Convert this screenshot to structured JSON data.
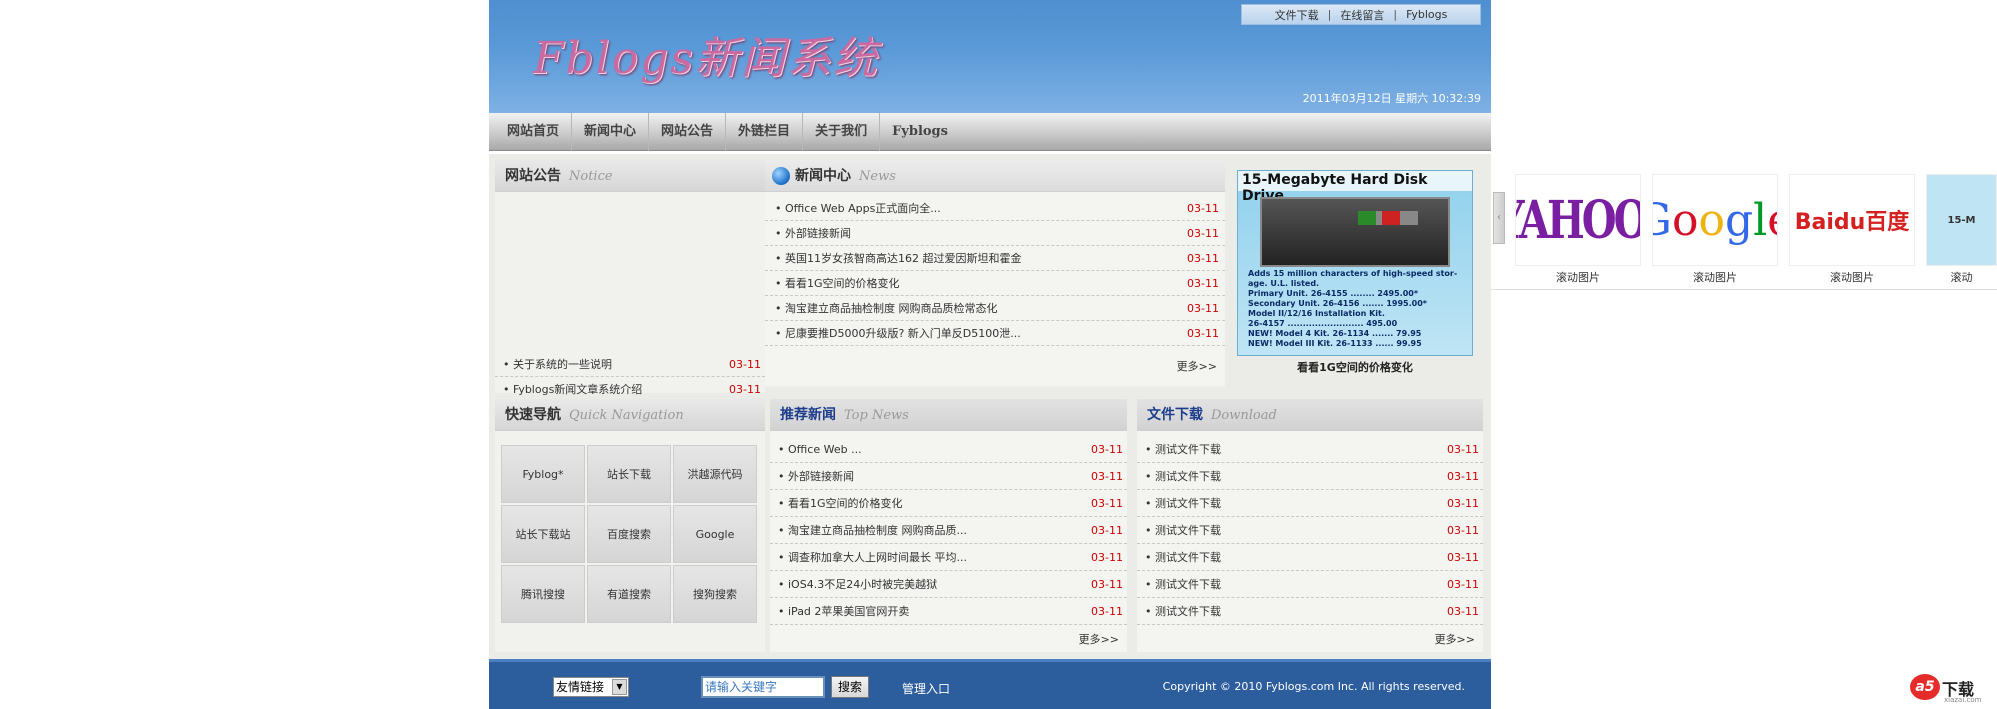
{
  "header": {
    "logo_text": "Fblogs新闻系统",
    "toplinks": [
      "文件下载",
      "在线留言",
      "Fyblogs"
    ],
    "toplinks_sep": "|",
    "datetime": "2011年03月12日 星期六 10:32:39"
  },
  "nav": {
    "items": [
      "网站首页",
      "新闻中心",
      "网站公告",
      "外链栏目",
      "关于我们",
      "Fyblogs"
    ]
  },
  "notice": {
    "title": "网站公告",
    "title_en": "Notice",
    "items": [
      {
        "title": "关于系统的一些说明",
        "date": "03-11"
      },
      {
        "title": "Fyblogs新闻文章系统介绍",
        "date": "03-11"
      }
    ]
  },
  "quicknav": {
    "title": "快速导航",
    "title_en": "Quick Navigation",
    "links": [
      "Fyblog*",
      "站长下载",
      "洪越源代码",
      "站长下载站",
      "百度搜索",
      "Google",
      "腾讯搜搜",
      "有道搜索",
      "搜狗搜索"
    ]
  },
  "news": {
    "title": "新闻中心",
    "title_en": "News",
    "items": [
      {
        "title": "Office Web Apps正式面向全...",
        "date": "03-11"
      },
      {
        "title": "外部链接新闻",
        "date": "03-11"
      },
      {
        "title": "英国11岁女孩智商高达162 超过爱因斯坦和霍金",
        "date": "03-11"
      },
      {
        "title": "看看1G空间的价格变化",
        "date": "03-11"
      },
      {
        "title": "淘宝建立商品抽检制度 网购商品质检常态化",
        "date": "03-11"
      },
      {
        "title": "尼康要推D5000升级版? 新入门单反D5100泄...",
        "date": "03-11"
      }
    ],
    "more": "更多>>"
  },
  "ad": {
    "heading": "15-Megabyte Hard Disk Drive",
    "lines": [
      "Adds 15 million characters of high-speed stor-",
      "age. U.L. listed.",
      "Primary Unit. 26-4155 ........ 2495.00*",
      "Secondary Unit. 26-4156 ....... 1995.00*",
      "Model II/12/16 Installation Kit.",
      "26-4157 ......................... 495.00",
      "NEW! Model 4 Kit. 26-1134 ....... 79.95",
      "NEW! Model III Kit. 26-1133 ...... 99.95"
    ],
    "caption": "看看1G空间的价格变化"
  },
  "topnews": {
    "title": "推荐新闻",
    "title_en": "Top News",
    "items": [
      {
        "title": "Office Web ...",
        "date": "03-11"
      },
      {
        "title": "外部链接新闻",
        "date": "03-11"
      },
      {
        "title": "看看1G空间的价格变化",
        "date": "03-11"
      },
      {
        "title": "淘宝建立商品抽检制度 网购商品质...",
        "date": "03-11"
      },
      {
        "title": "调查称加拿大人上网时间最长 平均...",
        "date": "03-11"
      },
      {
        "title": "iOS4.3不足24小时被完美越狱",
        "date": "03-11"
      },
      {
        "title": "iPad 2苹果美国官网开卖",
        "date": "03-11"
      }
    ],
    "more": "更多>>"
  },
  "download": {
    "title": "文件下载",
    "title_en": "Download",
    "items": [
      {
        "title": "测试文件下载",
        "date": "03-11"
      },
      {
        "title": "测试文件下载",
        "date": "03-11"
      },
      {
        "title": "测试文件下载",
        "date": "03-11"
      },
      {
        "title": "测试文件下载",
        "date": "03-11"
      },
      {
        "title": "测试文件下载",
        "date": "03-11"
      },
      {
        "title": "测试文件下载",
        "date": "03-11"
      },
      {
        "title": "测试文件下载",
        "date": "03-11"
      }
    ],
    "more": "更多>>"
  },
  "footer": {
    "friend_links": "友情链接",
    "search_placeholder": "请输入关键字",
    "search_button": "搜索",
    "admin": "管理入口",
    "copyright": "Copyright © 2010 Fyblogs.com Inc. All rights reserved."
  },
  "scroller": {
    "items": [
      {
        "logo": "YAHOO!",
        "caption": "滚动图片"
      },
      {
        "logo": "Google",
        "caption": "滚动图片"
      },
      {
        "logo": "Baidu百度",
        "caption": "滚动图片"
      },
      {
        "logo": "15-M",
        "caption": "滚动"
      }
    ]
  },
  "watermark": {
    "brand": "a5",
    "text": "下载",
    "url": "xiazai.com"
  },
  "colors": {
    "date_red": "#cc0000",
    "header_blue": "#5b9ad8",
    "footer_blue": "#2c5d9c",
    "title_navy": "#1d3d8c"
  }
}
